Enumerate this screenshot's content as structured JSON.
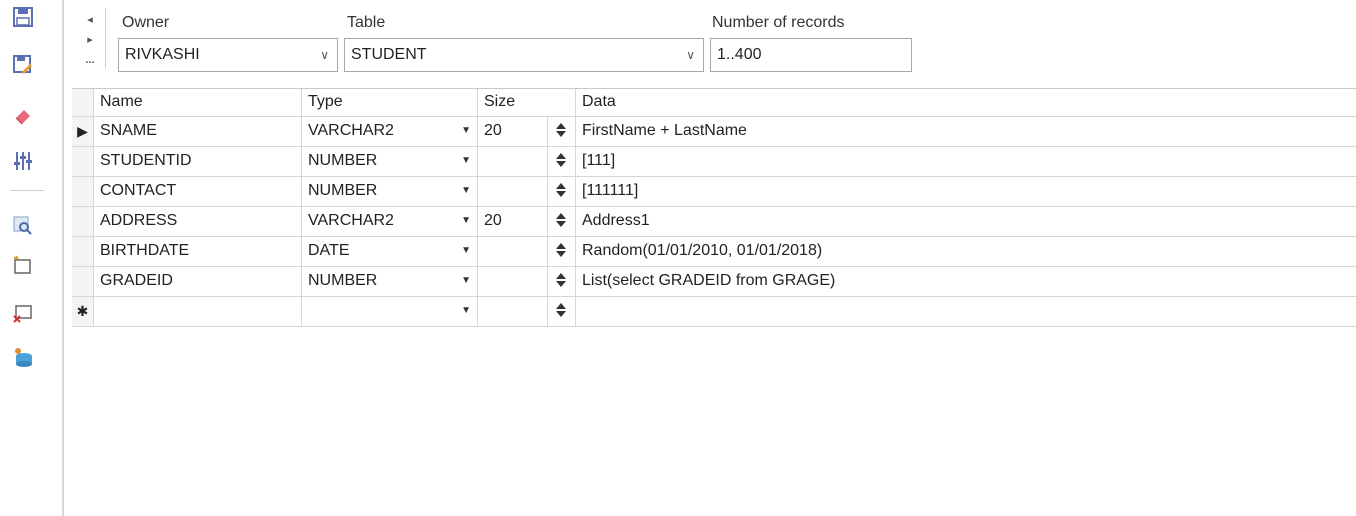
{
  "toolbar": {
    "icons": [
      "save-icon",
      "save-as-icon",
      "eraser-icon",
      "filter-settings-icon",
      "search-table-icon",
      "new-table-icon",
      "delete-table-icon",
      "database-icon"
    ],
    "accent": "#6a7fc0"
  },
  "nav": {
    "prev": "◂",
    "next": "▸",
    "more": "..."
  },
  "owner": {
    "label": "Owner",
    "value": "RIVKASHI"
  },
  "table": {
    "label": "Table",
    "value": "STUDENT"
  },
  "records": {
    "label": "Number of records",
    "value": "1..400"
  },
  "grid": {
    "headers": {
      "name": "Name",
      "type": "Type",
      "size": "Size",
      "data": "Data"
    },
    "rows": [
      {
        "indicator": "▶",
        "name": "SNAME",
        "type": "VARCHAR2",
        "size": "20",
        "data": "FirstName + LastName"
      },
      {
        "indicator": "",
        "name": "STUDENTID",
        "type": "NUMBER",
        "size": "",
        "data": "[111]"
      },
      {
        "indicator": "",
        "name": "CONTACT",
        "type": "NUMBER",
        "size": "",
        "data": "[111111]"
      },
      {
        "indicator": "",
        "name": "ADDRESS",
        "type": "VARCHAR2",
        "size": "20",
        "data": "Address1"
      },
      {
        "indicator": "",
        "name": "BIRTHDATE",
        "type": "DATE",
        "size": "",
        "data": "Random(01/01/2010, 01/01/2018)"
      },
      {
        "indicator": "",
        "name": "GRADEID",
        "type": "NUMBER",
        "size": "",
        "data": "List(select GRADEID from GRAGE)"
      },
      {
        "indicator": "✱",
        "name": "",
        "type": "",
        "size": "",
        "data": ""
      }
    ]
  }
}
